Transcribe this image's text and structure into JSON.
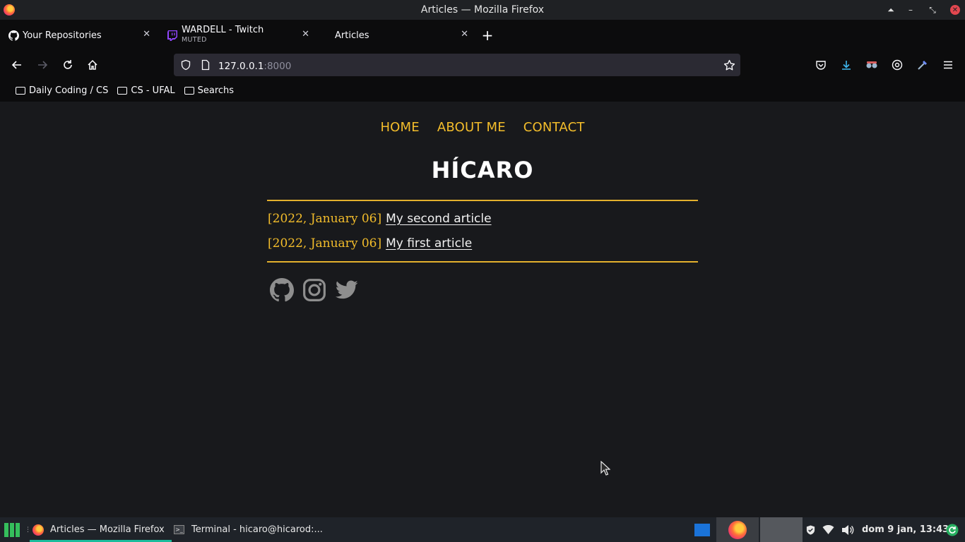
{
  "window": {
    "title": "Articles — Mozilla Firefox"
  },
  "tabs": [
    {
      "title": "Your Repositories",
      "subtitle": "",
      "favicon": "github-icon"
    },
    {
      "title": "WARDELL - Twitch",
      "subtitle": "MUTED",
      "favicon": "twitch-icon"
    },
    {
      "title": "Articles",
      "subtitle": "",
      "favicon": "none"
    }
  ],
  "urlbar": {
    "host": "127.0.0.1",
    "port": ":8000"
  },
  "bookmarks": [
    "Daily Coding / CS",
    "CS - UFAL",
    "Searchs"
  ],
  "site": {
    "nav": [
      "HOME",
      "ABOUT ME",
      "CONTACT"
    ],
    "title": "HÍCARO",
    "articles": [
      {
        "date": "[2022, January 06]",
        "title": "My second article"
      },
      {
        "date": "[2022, January 06]",
        "title": "My first article"
      }
    ],
    "social": [
      "github-icon",
      "instagram-icon",
      "twitter-icon"
    ],
    "accent": "#f3bd2b"
  },
  "taskbar": {
    "windows": [
      "Articles — Mozilla Firefox",
      "Terminal - hicaro@hicarod:..."
    ],
    "clock": "dom  9 jan, 13:43"
  }
}
